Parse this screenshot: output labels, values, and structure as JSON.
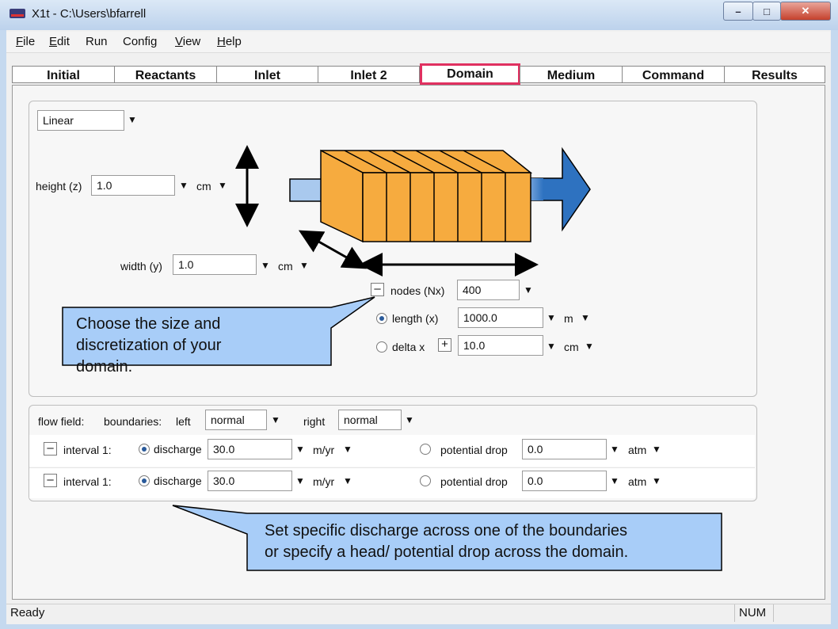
{
  "window": {
    "title": "X1t - C:\\Users\\bfarrell",
    "minimize": "–",
    "maximize": "□",
    "close": "✕"
  },
  "menu": [
    "File",
    "Edit",
    "Run",
    "Config",
    "View",
    "Help"
  ],
  "tabs": [
    "Initial",
    "Reactants",
    "Inlet",
    "Inlet 2",
    "Domain",
    "Medium",
    "Command",
    "Results"
  ],
  "active_tab": "Domain",
  "domain": {
    "geometry": "Linear",
    "height_label": "height (z)",
    "height_value": "1.0",
    "height_unit": "cm",
    "width_label": "width (y)",
    "width_value": "1.0",
    "width_unit": "cm",
    "nodes_label": "nodes (Nx)",
    "nodes_value": "400",
    "length_label": "length (x)",
    "length_value": "1000.0",
    "length_unit": "m",
    "delta_label": "delta x",
    "delta_value": "10.0",
    "delta_unit": "cm",
    "callout": "Choose the size and discretization of your domain."
  },
  "flow": {
    "flow_label": "flow field:",
    "boundaries_label": "boundaries:",
    "left_label": "left",
    "left_value": "normal",
    "right_label": "right",
    "right_value": "normal",
    "intervals": [
      {
        "label": "interval 1:",
        "discharge_label": "discharge",
        "discharge_value": "30.0",
        "discharge_unit": "m/yr",
        "potential_label": "potential drop",
        "potential_value": "0.0",
        "potential_unit": "atm"
      },
      {
        "label": "interval 1:",
        "discharge_label": "discharge",
        "discharge_value": "30.0",
        "discharge_unit": "m/yr",
        "potential_label": "potential drop",
        "potential_value": "0.0",
        "potential_unit": "atm"
      }
    ],
    "callout_line1": "Set specific discharge across one of the boundaries",
    "callout_line2": "or specify a head/ potential drop across the domain."
  },
  "status": {
    "text": "Ready",
    "num": "NUM"
  },
  "icons": {
    "dropdown": "triangle-down-icon",
    "minus": "minus-icon",
    "plus": "plus-icon"
  },
  "colors": {
    "cell_fill": "#f6ab3f",
    "arrow_blue": "#2e72c0",
    "callout_fill": "#a8cdf8",
    "tab_highlight": "#e03060"
  }
}
